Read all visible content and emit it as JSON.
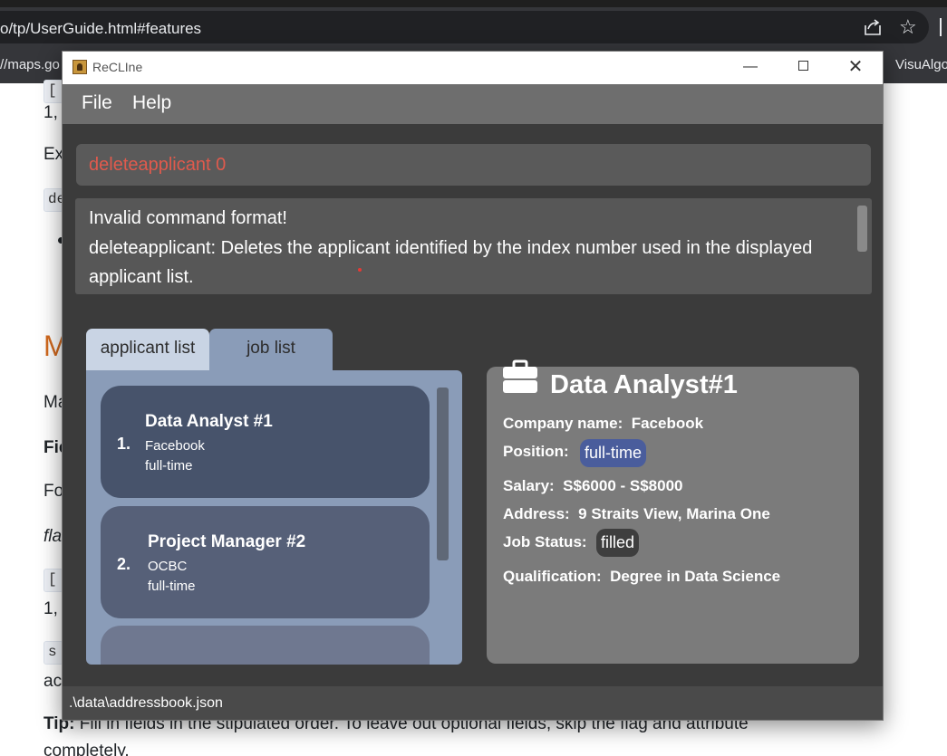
{
  "browser": {
    "url": "o/tp/UserGuide.html#features",
    "bookmarks": [
      "//maps.go",
      "VisuAlgo"
    ],
    "share_icon": "share-icon",
    "star_icon": "star-icon"
  },
  "document": {
    "fragments": {
      "f1": "1,",
      "f2": "Ex",
      "f3": "de",
      "f4": "M",
      "f5": "Ma",
      "f6": "Fie",
      "f7": "Fo",
      "f8": "fla",
      "f9": "[",
      "f10": "1,",
      "f11": "s",
      "f12": "ac",
      "f13": "[",
      "f14": "[",
      "tip_label": "Tip:",
      "tip_text": " Fill in fields in the stipulated order. To leave out optional fields, skip the flag and attribute",
      "tip_cont": "completely."
    }
  },
  "window": {
    "title": "ReCLIne",
    "controls": {
      "minimize": "—",
      "maximize": "",
      "close": "✕"
    }
  },
  "menu": [
    "File",
    "Help"
  ],
  "command": {
    "text": "deleteapplicant 0"
  },
  "result": {
    "lines": [
      "Invalid command format!",
      "deleteapplicant: Deletes the applicant identified by the index number used in the displayed",
      "applicant list."
    ]
  },
  "tabs": [
    "applicant list",
    "job list"
  ],
  "jobs": [
    {
      "index": "1.",
      "title": "Data Analyst  #1",
      "company": "Facebook",
      "type": "full-time"
    },
    {
      "index": "2.",
      "title": "Project Manager  #2",
      "company": "OCBC",
      "type": "full-time"
    }
  ],
  "detail": {
    "icon": "briefcase-icon",
    "title": "Data Analyst#1",
    "company_label": "Company name:",
    "company": "Facebook",
    "position_label": "Position:",
    "position": "full-time",
    "salary_label": "Salary:",
    "salary": "S$6000 - S$8000",
    "address_label": "Address:",
    "address": "9 Straits View, Marina One",
    "status_label": "Job Status:",
    "status": "filled",
    "qualification_label": "Qualification:",
    "qualification": "Degree in Data Science"
  },
  "status_bar": {
    "path": ".\\data\\addressbook.json"
  },
  "colors": {
    "command_error": "#e05a4d",
    "position_pill": "#4a5d9c",
    "status_pill": "#3e3e3e",
    "menu_bg": "#6e6e6e",
    "app_bg": "#3b3b3b"
  }
}
